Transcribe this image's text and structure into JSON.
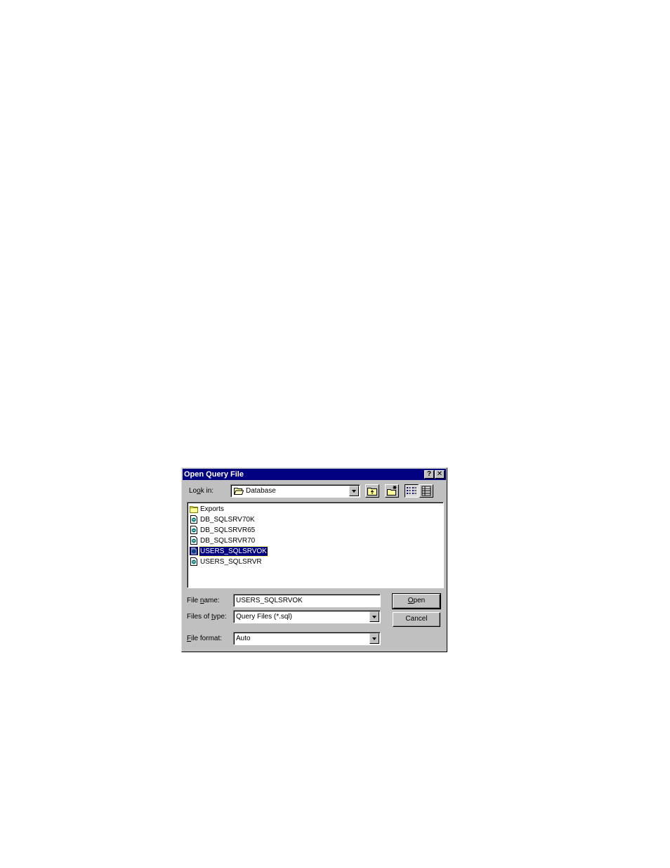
{
  "dialog": {
    "title": "Open Query File",
    "help_button": "?",
    "close_button": "✕"
  },
  "look_in": {
    "label_pre": "Lo",
    "label_key": "o",
    "label_post": "k in:",
    "value": "Database"
  },
  "toolbar": {
    "buttons": [
      "up-one-level",
      "create-new-folder",
      "list-view",
      "details-view"
    ]
  },
  "files": [
    {
      "name": "Exports",
      "type": "folder",
      "selected": false
    },
    {
      "name": "DB_SQLSRV70K",
      "type": "sql-file",
      "selected": false
    },
    {
      "name": "DB_SQLSRVR65",
      "type": "sql-file",
      "selected": false
    },
    {
      "name": "DB_SQLSRVR70",
      "type": "sql-file",
      "selected": false
    },
    {
      "name": "USERS_SQLSRVOK",
      "type": "sql-file",
      "selected": true
    },
    {
      "name": "USERS_SQLSRVR",
      "type": "sql-file",
      "selected": false
    }
  ],
  "file_name": {
    "label_pre": "File ",
    "label_key": "n",
    "label_post": "ame:",
    "value": "USERS_SQLSRVOK"
  },
  "files_of_type": {
    "label_pre": "Files of ",
    "label_key": "t",
    "label_post": "ype:",
    "value": "Query Files (*.sql)"
  },
  "file_format": {
    "label_pre": "",
    "label_key": "F",
    "label_post": "ile format:",
    "value": "Auto"
  },
  "buttons": {
    "open_key": "O",
    "open_rest": "pen",
    "cancel": "Cancel"
  }
}
